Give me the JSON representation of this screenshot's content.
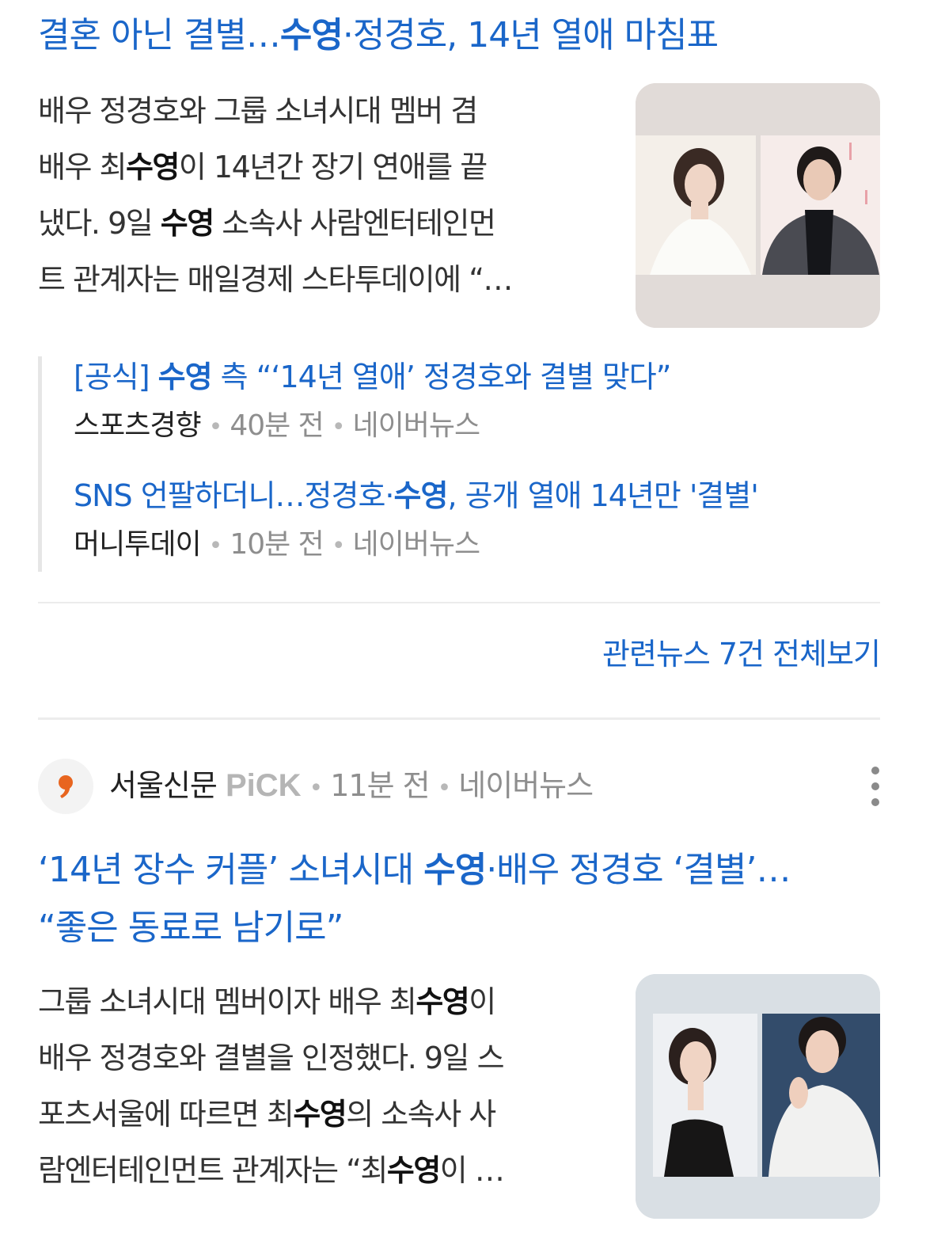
{
  "card1": {
    "title": {
      "pre": "결혼 아닌 결별…",
      "bold": "수영",
      "post": "·정경호, 14년 열애 마침표"
    },
    "snippet": [
      {
        "a": "배우 정경호와 그룹 소녀시대 멤버 겸",
        "b": "",
        "c": ""
      },
      {
        "a": "배우 최",
        "b": "수영",
        "c": "이 14년간 장기 연애를 끝"
      },
      {
        "a": "냈다. 9일 ",
        "b": "수영",
        "c": " 소속사 사람엔터테인먼"
      },
      {
        "a": "트 관계자는 매일경제 스타투데이에 “…",
        "b": "",
        "c": ""
      }
    ],
    "thumbnail_alt": "수영 정경호 사진"
  },
  "related": [
    {
      "title_pre": "[공식] ",
      "title_bold": "수영",
      "title_post": " 측 “‘14년 열애’ 정경호와 결별 맞다”",
      "source": "스포츠경향",
      "time": "40분 전",
      "platform": "네이버뉴스"
    },
    {
      "title_pre": "SNS 언팔하더니…정경호·",
      "title_bold": "수영",
      "title_post": ", 공개 열애 14년만 '결별'",
      "source": "머니투데이",
      "time": "10분 전",
      "platform": "네이버뉴스"
    }
  ],
  "more_related": "관련뉴스 7건 전체보기",
  "card2": {
    "source": "서울신문",
    "badge": "PiCK",
    "time": "11분 전",
    "platform": "네이버뉴스",
    "title_line1": {
      "pre": "‘14년 장수 커플’ 소녀시대 ",
      "bold": "수영",
      "post": "·배우 정경호 ‘결별’…"
    },
    "title_line2": "“좋은 동료로 남기로”",
    "snippet": [
      {
        "a": "그룹 소녀시대 멤버이자 배우 최",
        "b": "수영",
        "c": "이"
      },
      {
        "a": "배우 정경호와 결별을 인정했다. 9일 스",
        "b": "",
        "c": ""
      },
      {
        "a": "포츠서울에 따르면 최",
        "b": "수영",
        "c": "의 소속사 사"
      },
      {
        "a": "람엔터테인먼트 관계자는 “최",
        "b": "수영",
        "c": "이 …"
      }
    ],
    "thumbnail_alt": "수영 정경호 사진"
  },
  "colors": {
    "link": "#1a66c9",
    "text": "#222222",
    "meta": "#8e8e8e",
    "logo_accent": "#e8651f"
  },
  "icons": {
    "source_logo": "seoul-shinmun-logo",
    "more_menu": "more-vertical-icon"
  }
}
